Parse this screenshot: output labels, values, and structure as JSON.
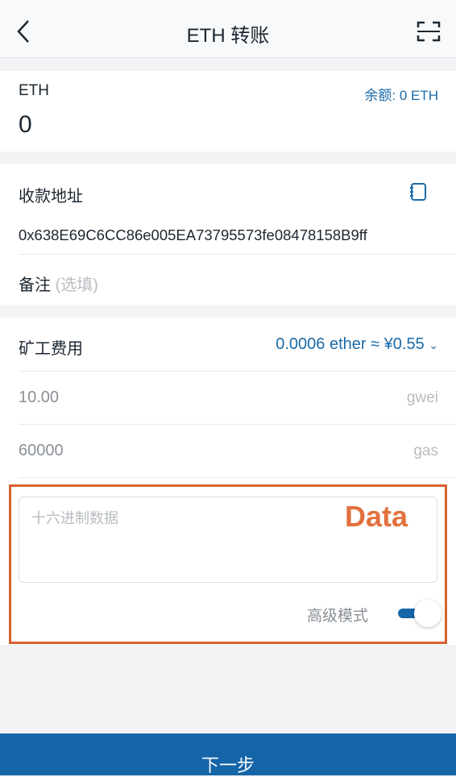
{
  "header": {
    "title": "ETH 转账",
    "back_icon": "chevron-left-icon",
    "scan_icon": "scan-icon"
  },
  "amount": {
    "token": "ETH",
    "balance": "余额: 0 ETH",
    "value": "0"
  },
  "recipient": {
    "label": "收款地址",
    "address": "0x638E69C6CC86e005EA73795573fe08478158B9ff",
    "address_book_icon": "address-book-icon",
    "memo_label": "备注",
    "memo_placeholder": "(选填)"
  },
  "fee": {
    "label": "矿工费用",
    "summary": "0.0006 ether ≈ ¥0.55",
    "gas_price": "10.00",
    "gas_price_unit": "gwei",
    "gas_limit": "60000",
    "gas_limit_unit": "gas",
    "data_placeholder": "十六进制数据",
    "advanced_label": "高级模式",
    "advanced_on": true
  },
  "annotation": {
    "label": "Data"
  },
  "footer": {
    "next_label": "下一步"
  },
  "colors": {
    "accent": "#1565a8",
    "annotation": "#d9612f"
  }
}
